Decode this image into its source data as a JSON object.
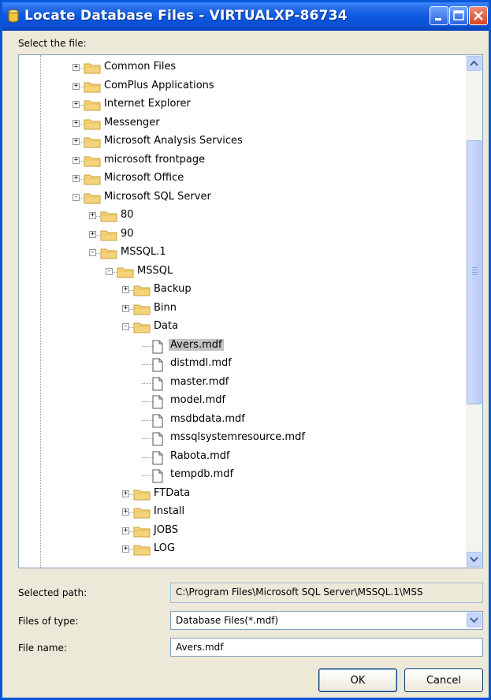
{
  "window": {
    "title": "Locate Database Files - VIRTUALXP-86734"
  },
  "select_label": "Select the file:",
  "tree": {
    "items": [
      {
        "label": "Common Files",
        "kind": "folder",
        "expander": "+",
        "depth": 0,
        "icon": "folder-icon"
      },
      {
        "label": "ComPlus Applications",
        "kind": "folder",
        "expander": "+",
        "depth": 0,
        "icon": "folder-icon"
      },
      {
        "label": "Internet Explorer",
        "kind": "folder",
        "expander": "+",
        "depth": 0,
        "icon": "folder-icon"
      },
      {
        "label": "Messenger",
        "kind": "folder",
        "expander": "+",
        "depth": 0,
        "icon": "folder-icon"
      },
      {
        "label": "Microsoft Analysis Services",
        "kind": "folder",
        "expander": "+",
        "depth": 0,
        "icon": "folder-icon"
      },
      {
        "label": "microsoft frontpage",
        "kind": "folder",
        "expander": "+",
        "depth": 0,
        "icon": "folder-icon"
      },
      {
        "label": "Microsoft Office",
        "kind": "folder",
        "expander": "+",
        "depth": 0,
        "icon": "folder-icon"
      },
      {
        "label": "Microsoft SQL Server",
        "kind": "folder",
        "expander": "-",
        "depth": 0,
        "icon": "folder-icon"
      },
      {
        "label": "80",
        "kind": "folder",
        "expander": "+",
        "depth": 1,
        "icon": "folder-icon"
      },
      {
        "label": "90",
        "kind": "folder",
        "expander": "+",
        "depth": 1,
        "icon": "folder-icon"
      },
      {
        "label": "MSSQL.1",
        "kind": "folder",
        "expander": "-",
        "depth": 1,
        "icon": "folder-icon"
      },
      {
        "label": "MSSQL",
        "kind": "folder",
        "expander": "-",
        "depth": 2,
        "icon": "folder-icon"
      },
      {
        "label": "Backup",
        "kind": "folder",
        "expander": "+",
        "depth": 3,
        "icon": "folder-icon"
      },
      {
        "label": "Binn",
        "kind": "folder",
        "expander": "+",
        "depth": 3,
        "icon": "folder-icon"
      },
      {
        "label": "Data",
        "kind": "folder",
        "expander": "-",
        "depth": 3,
        "icon": "folder-icon"
      },
      {
        "label": "Avers.mdf",
        "kind": "file",
        "expander": "",
        "depth": 4,
        "icon": "file-icon",
        "selected": true
      },
      {
        "label": "distmdl.mdf",
        "kind": "file",
        "expander": "",
        "depth": 4,
        "icon": "file-icon"
      },
      {
        "label": "master.mdf",
        "kind": "file",
        "expander": "",
        "depth": 4,
        "icon": "file-icon"
      },
      {
        "label": "model.mdf",
        "kind": "file",
        "expander": "",
        "depth": 4,
        "icon": "file-icon"
      },
      {
        "label": "msdbdata.mdf",
        "kind": "file",
        "expander": "",
        "depth": 4,
        "icon": "file-icon"
      },
      {
        "label": "mssqlsystemresource.mdf",
        "kind": "file",
        "expander": "",
        "depth": 4,
        "icon": "file-icon"
      },
      {
        "label": "Rabota.mdf",
        "kind": "file",
        "expander": "",
        "depth": 4,
        "icon": "file-icon"
      },
      {
        "label": "tempdb.mdf",
        "kind": "file",
        "expander": "",
        "depth": 4,
        "icon": "file-icon"
      },
      {
        "label": "FTData",
        "kind": "folder",
        "expander": "+",
        "depth": 3,
        "icon": "folder-icon"
      },
      {
        "label": "Install",
        "kind": "folder",
        "expander": "+",
        "depth": 3,
        "icon": "folder-icon"
      },
      {
        "label": "JOBS",
        "kind": "folder",
        "expander": "+",
        "depth": 3,
        "icon": "folder-icon"
      },
      {
        "label": "LOG",
        "kind": "folder",
        "expander": "+",
        "depth": 3,
        "icon": "folder-icon"
      }
    ]
  },
  "selected_path": {
    "label": "Selected path:",
    "value": "C:\\Program Files\\Microsoft SQL Server\\MSSQL.1\\MSS"
  },
  "files_of_type": {
    "label": "Files of type:",
    "value": "Database Files(*.mdf)"
  },
  "file_name": {
    "label": "File name:",
    "value": "Avers.mdf"
  },
  "buttons": {
    "ok": "OK",
    "cancel": "Cancel"
  },
  "colors": {
    "titlebar": "#0b57df",
    "dialog_bg": "#ece9d8",
    "folder": "#f5d37c",
    "selection": "#c3c3c3"
  }
}
